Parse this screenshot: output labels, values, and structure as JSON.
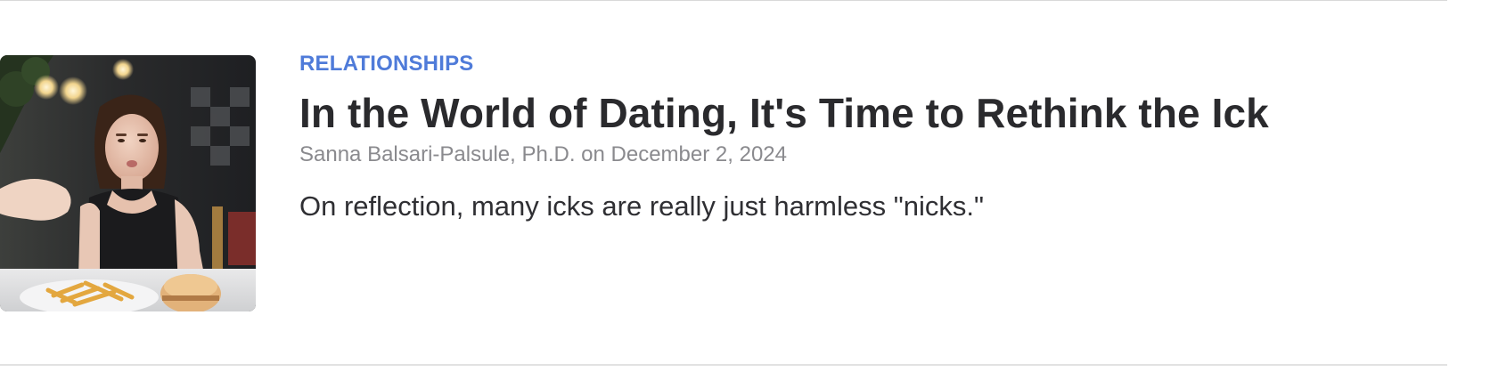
{
  "article": {
    "category": "RELATIONSHIPS",
    "title": "In the World of Dating, It's Time to Rethink the Ick",
    "author": "Sanna Balsari-Palsule, Ph.D.",
    "byline_joiner": " on ",
    "date": "December 2, 2024",
    "teaser": "On reflection, many icks are really just harmless \"nicks.\""
  },
  "colors": {
    "category": "#4f7bd9",
    "title": "#2a2a2d",
    "byline": "#8a8a8e",
    "teaser": "#2f2f33",
    "divider": "#e2e2e2"
  },
  "image": {
    "subject": "woman-at-restaurant-table-with-fries-and-burger"
  }
}
